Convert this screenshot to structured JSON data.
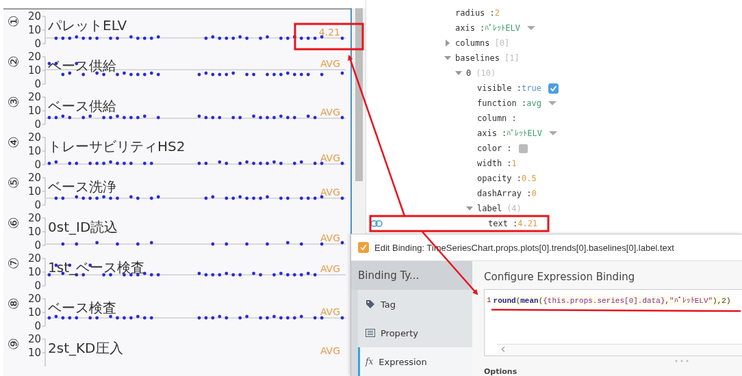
{
  "charts": [
    {
      "number": "①",
      "title": "パレットELV",
      "ticks": [
        "20",
        "10",
        "0"
      ],
      "baseline_label": "4.21"
    },
    {
      "number": "②",
      "title": "ベース供給",
      "ticks": [
        "20",
        "10",
        "0"
      ],
      "baseline_label": "AVG"
    },
    {
      "number": "③",
      "title": "ベース供給",
      "ticks": [
        "20",
        "10",
        "0"
      ],
      "baseline_label": "AVG"
    },
    {
      "number": "④",
      "title": "トレーサビリティHS2",
      "ticks": [
        "20",
        "10",
        "0"
      ],
      "baseline_label": "AVG"
    },
    {
      "number": "⑤",
      "title": "ベース洗浄",
      "ticks": [
        "20",
        "10",
        "0"
      ],
      "baseline_label": "AVG"
    },
    {
      "number": "⑥",
      "title": "0st_ID読込",
      "ticks": [
        "20",
        "10",
        "0"
      ],
      "baseline_label": "AVG"
    },
    {
      "number": "⑦",
      "title": "1st_ベース検査",
      "ticks": [
        "20",
        "10",
        "0"
      ],
      "baseline_label": "AVG"
    },
    {
      "number": "⑧",
      "title": "ベース検査",
      "ticks": [
        "20",
        "10",
        "0"
      ],
      "baseline_label": "AVG"
    },
    {
      "number": "⑨",
      "title": "2st_KD圧入",
      "ticks": [
        "20",
        "10"
      ],
      "baseline_label": "AVG"
    }
  ],
  "tree": {
    "items": [
      {
        "key": "radius :",
        "value": "2",
        "kind": "number",
        "bound": false
      },
      {
        "key": "axis :",
        "value": "ﾊﾟﾚｯﾄELV",
        "kind": "choice",
        "bound": false
      },
      {
        "key": "columns",
        "value": "[0]",
        "kind": "count",
        "expanded": false,
        "bound": false
      },
      {
        "key": "baselines",
        "value": "[1]",
        "kind": "count",
        "expanded": true,
        "bound": false,
        "children": [
          {
            "key": "0",
            "value": "(10)",
            "kind": "count",
            "expanded": true,
            "bound": false,
            "children": [
              {
                "key": "visible :",
                "value": "true",
                "kind": "boolean",
                "checked": true,
                "bound": false
              },
              {
                "key": "function :",
                "value": "avg",
                "kind": "choice",
                "bound": false
              },
              {
                "key": "column :",
                "kind": "empty",
                "bound": false
              },
              {
                "key": "axis :",
                "value": "ﾊﾟﾚｯﾄELV",
                "kind": "choice",
                "bound": false
              },
              {
                "key": "color :",
                "kind": "swatch",
                "color": "#bbbbbb",
                "bound": false
              },
              {
                "key": "width :",
                "value": "1",
                "kind": "number",
                "bound": false
              },
              {
                "key": "opacity :",
                "value": "0.5",
                "kind": "number",
                "bound": false
              },
              {
                "key": "dashArray :",
                "value": "0",
                "kind": "number",
                "bound": false
              },
              {
                "key": "label",
                "value": "(4)",
                "kind": "count",
                "expanded": true,
                "bound": false,
                "children": [
                  {
                    "key": "text :",
                    "value": "4.21",
                    "kind": "number",
                    "bound": true
                  }
                ]
              }
            ]
          }
        ]
      }
    ]
  },
  "dialog": {
    "title": "Edit Binding: TimeSeriesChart.props.plots[0].trends[0].baselines[0].label.text",
    "sidebar_title": "Binding Ty...",
    "binding_types": [
      {
        "label": "Tag",
        "kind": "tag",
        "selected": false
      },
      {
        "label": "Property",
        "kind": "property",
        "selected": false
      },
      {
        "label": "Expression",
        "kind": "expression",
        "glyph": "fx",
        "selected": true
      }
    ],
    "heading": "Configure Expression Binding",
    "editor": {
      "line_number": "1",
      "tokens": [
        {
          "text": "round",
          "kind": "function"
        },
        {
          "text": "(",
          "kind": "plain"
        },
        {
          "text": "mean",
          "kind": "function"
        },
        {
          "text": "(",
          "kind": "plain"
        },
        {
          "text": "{this.props.series[0].data}",
          "kind": "reference"
        },
        {
          "text": ",",
          "kind": "plain"
        },
        {
          "text": "\"ﾊﾟﾚｯﾄELV\"",
          "kind": "string"
        },
        {
          "text": "),2)",
          "kind": "plain"
        }
      ]
    },
    "options_label": "Options"
  }
}
